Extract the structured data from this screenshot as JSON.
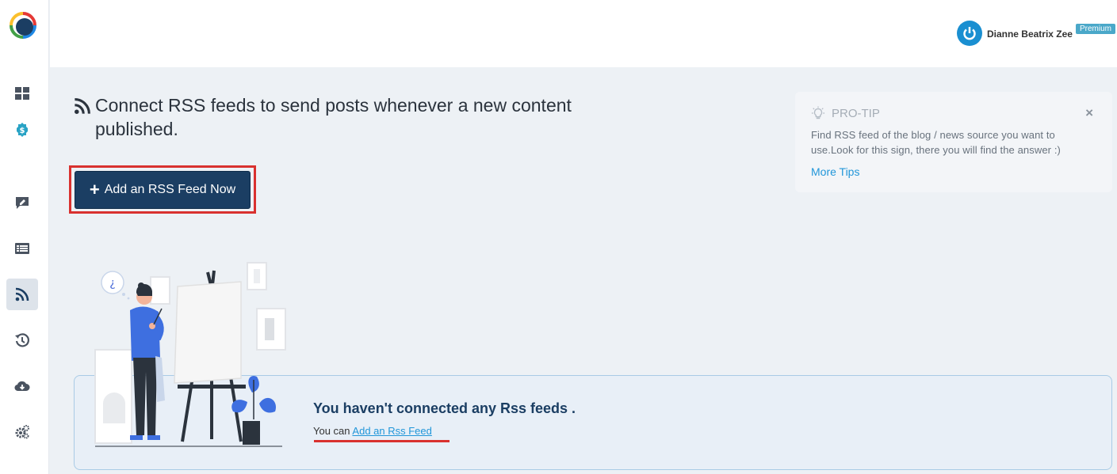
{
  "user": {
    "name": "Dianne Beatrix Zee",
    "badge": "Premium"
  },
  "sidebar": {
    "items": [
      {
        "icon": "dashboard-icon"
      },
      {
        "icon": "dollar-icon"
      },
      {
        "icon": "compose-icon"
      },
      {
        "icon": "list-icon"
      },
      {
        "icon": "rss-icon",
        "active": true
      },
      {
        "icon": "history-icon"
      },
      {
        "icon": "cloud-download-icon"
      },
      {
        "icon": "settings-icon"
      }
    ]
  },
  "main": {
    "title": "Connect RSS feeds to send posts whenever a new content published.",
    "cta_label": "Add an RSS Feed Now"
  },
  "protip": {
    "heading": "PRO-TIP",
    "text": "Find RSS feed of the blog / news source you want to use.Look for this sign, there you will find the answer :)",
    "link": "More Tips",
    "close": "×"
  },
  "empty_state": {
    "title": "You haven't connected any Rss feeds .",
    "prefix": "You can",
    "link": "Add an Rss Feed"
  },
  "colors": {
    "primary": "#1b3e63",
    "link": "#2196d9",
    "highlight": "#d9312f"
  }
}
